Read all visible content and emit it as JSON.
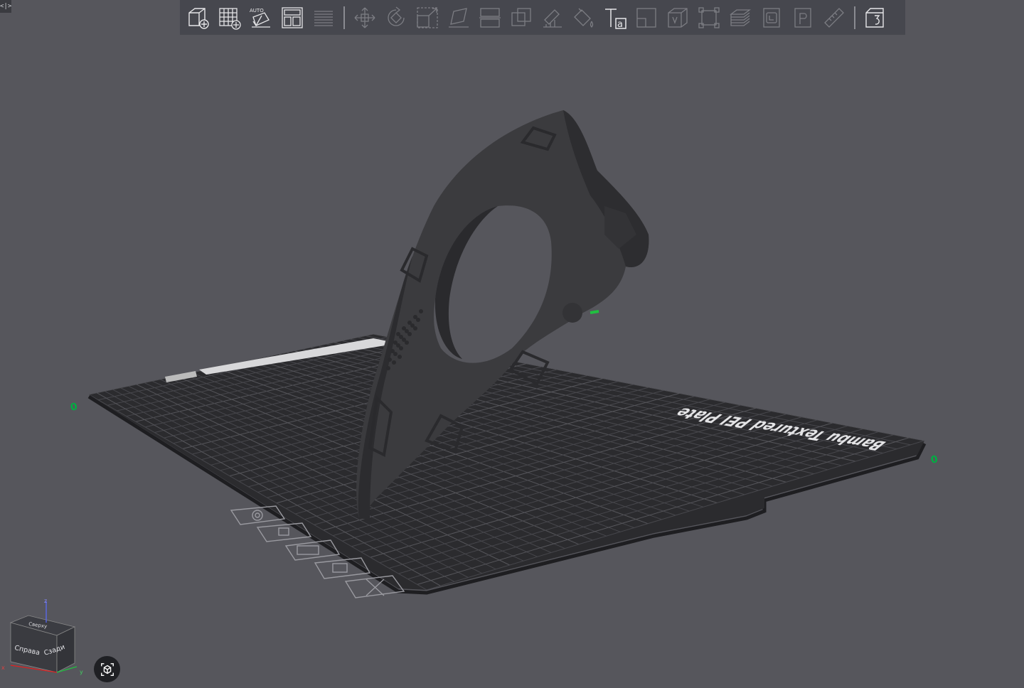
{
  "toggle": {
    "label": "<|>"
  },
  "toolbar": {
    "groups": [
      [
        "add-object-icon",
        "add-plate-icon",
        "auto-orient-icon",
        "arrange-icon",
        "split-layers-icon"
      ],
      [
        "move-icon",
        "rotate-icon",
        "scale-icon",
        "lay-on-face-icon",
        "cut-icon",
        "boolean-icon",
        "support-paint-icon",
        "color-paint-icon",
        "text-icon",
        "fuzzy-skin-icon",
        "variable-layer-icon",
        "mesh-boolean-icon",
        "assembly-icon",
        "layers-icon",
        "plate-1-icon",
        "plate-p-icon",
        "measure-icon"
      ],
      [
        "slice-view-icon"
      ]
    ]
  },
  "plate": {
    "name": "Bambu Textured PEI Plate",
    "origin_label": "0",
    "x_label": "0",
    "y_label": "0"
  },
  "plate_tools": [
    "settings-icon",
    "lock-icon",
    "arrange-plate-icon",
    "orient-plate-icon",
    "delete-plate-icon"
  ],
  "navcube": {
    "top_label": "Сверху",
    "right_label": "Справа",
    "back_label": "Сзади",
    "axis_x": "x",
    "axis_y": "y",
    "axis_z": "z"
  },
  "colors": {
    "background": "#56565c",
    "toolbar": "#46474e",
    "plate": "#2b2b2e",
    "grid": "#4a4a4f",
    "model": "#3a3a3c",
    "axis_x": "#e02020",
    "axis_y": "#20c040",
    "accent": "#00ae42"
  }
}
